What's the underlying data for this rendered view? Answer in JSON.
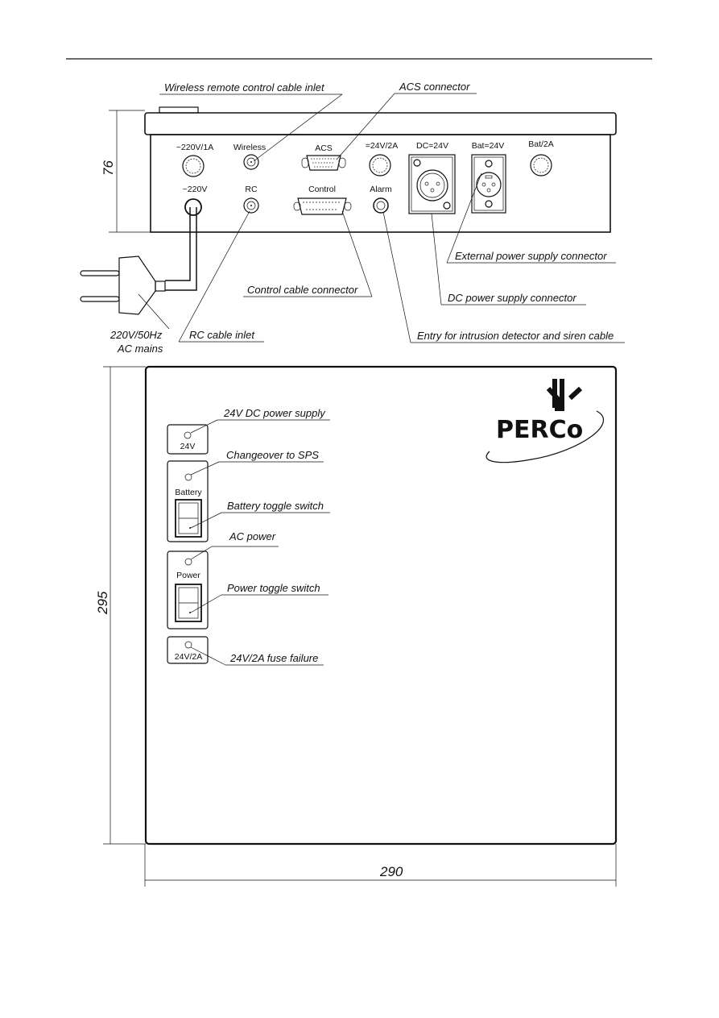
{
  "rear_panel": {
    "dimension_height": "76",
    "port_labels": [
      "~220V/1A",
      "Wireless",
      "ACS",
      "=24V/2A",
      "DC=24V",
      "Bat=24V",
      "Bat/2A",
      "~220V",
      "RC",
      "Control",
      "Alarm"
    ],
    "callouts": {
      "wireless": "Wireless remote control cable inlet",
      "acs": "ACS connector",
      "external_power": "External power supply connector",
      "control": "Control cable connector",
      "dc_power": "DC power supply connector",
      "mains_1": "220V/50Hz",
      "mains_2": "AC mains",
      "rc": "RC cable inlet",
      "alarm": "Entry for intrusion detector and siren cable"
    }
  },
  "front_panel": {
    "dimension_height": "295",
    "dimension_width": "290",
    "logo_text": "PERCo",
    "module_labels": [
      "24V",
      "Battery",
      "Power",
      "24V/2A"
    ],
    "callouts": {
      "dc_supply": "24V DC power supply",
      "changeover": "Changeover to SPS",
      "battery_switch": "Battery toggle switch",
      "ac_power": "AC power",
      "power_switch": "Power toggle switch",
      "fuse_failure": "24V/2A fuse failure"
    }
  }
}
